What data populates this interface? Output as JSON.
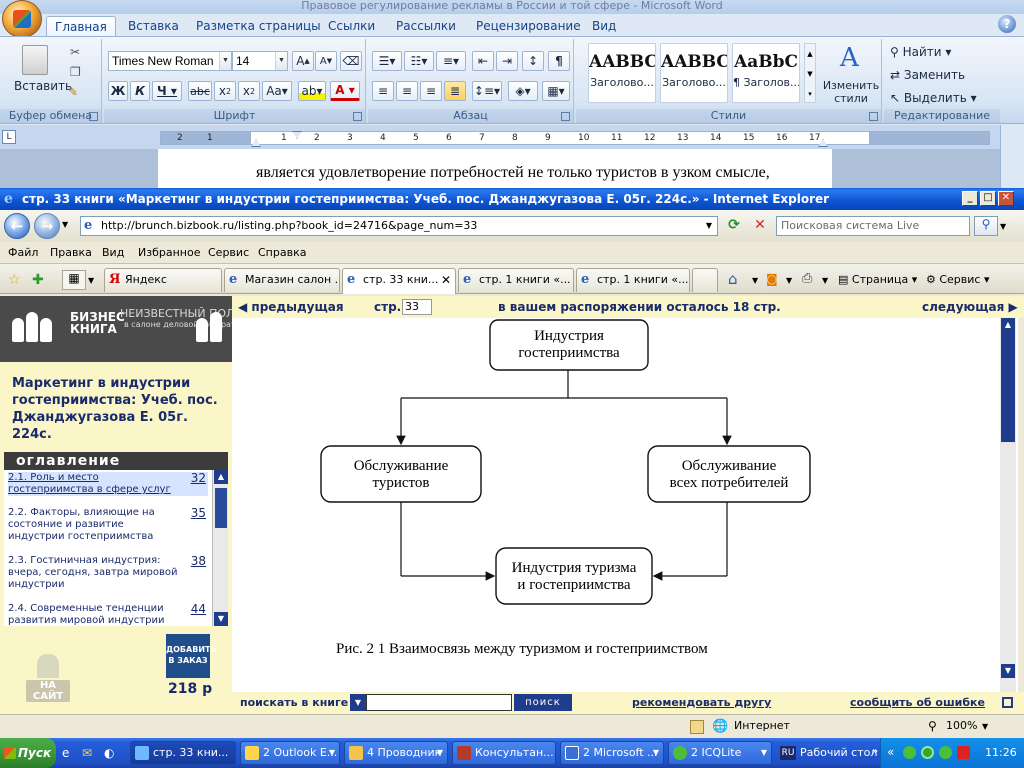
{
  "word": {
    "title": "Правовое регулирование рекламы в России и той сфере - Microsoft Word",
    "tabs": [
      "Главная",
      "Вставка",
      "Разметка страницы",
      "Ссылки",
      "Рассылки",
      "Рецензирование",
      "Вид"
    ],
    "groups": [
      "Буфер обмена",
      "Шрифт",
      "Абзац",
      "Стили",
      "Редактирование"
    ],
    "paste_label": "Вставить",
    "font_name": "Times New Roman",
    "font_size": "14",
    "styles": [
      {
        "sample": "AABBC",
        "name": "Заголово..."
      },
      {
        "sample": "AABBC",
        "name": "Заголово..."
      },
      {
        "sample": "AaBbC",
        "name": "¶ Заголов..."
      }
    ],
    "change_styles": "Изменить стили",
    "editing": [
      "Найти",
      "Заменить",
      "Выделить"
    ],
    "ruler_ticks": [
      "1",
      "2",
      "3",
      "4",
      "5",
      "6",
      "7",
      "8",
      "9",
      "10",
      "11",
      "12",
      "13",
      "14",
      "15",
      "16",
      "17"
    ],
    "ruler_left": [
      "2",
      "1",
      "1"
    ],
    "doc_text": "является удовлетворение потребностей не только туристов в узком смысле,"
  },
  "ie": {
    "title": "стр. 33 книги «Маркетинг в индустрии гостеприимства: Учеб. пос. Джанджугазова Е. 05г. 224с.» - Internet Explorer",
    "url": "http://brunch.bizbook.ru/listing.php?book_id=24716&page_num=33",
    "search_placeholder": "Поисковая система Live",
    "menu": [
      "Файл",
      "Правка",
      "Вид",
      "Избранное",
      "Сервис",
      "Справка"
    ],
    "tabs": [
      "Яндекс",
      "Магазин салон ...",
      "стр. 33 кни...",
      "стр. 1 книги «...",
      "стр. 1 книги «..."
    ],
    "tools": [
      "Страница",
      "Сервис"
    ]
  },
  "page": {
    "logo_text": "БИЗНЕС КНИГА",
    "logo_user": "НЕИЗВЕСТНЫЙ ПОЛЬЗОВАТЕЛЬ",
    "logo_sub": "в салоне деловой литературы",
    "book_title": "Маркетинг в индустрии гостеприимства: Учеб. пос. Джанджугазова Е. 05г. 224с.",
    "toc_header": "оглавление",
    "toc": [
      {
        "title": "2.1. Роль и место гостеприимства в сфере услуг",
        "page": "32"
      },
      {
        "title": "2.2. Факторы, влияющие на состояние и развитие индустрии гостеприимства",
        "page": "35"
      },
      {
        "title": "2.3. Гостиничная индустрия: вчера, сегодня, завтра мировой индустрии",
        "page": "38"
      },
      {
        "title": "2.4. Современные тенденции развития мировой индустрии",
        "page": "44"
      }
    ],
    "na_site": "НА САЙТ",
    "order_btn": "ДОБАВИТЬ В ЗАКАЗ",
    "price": "218 р",
    "nav_prev": "предыдущая",
    "nav_page_label": "стр.",
    "nav_page_value": "33",
    "nav_remaining": "в вашем распоряжении осталось 18 стр.",
    "nav_next": "следующая",
    "diagram": {
      "top": "Индустрия гостеприимства",
      "left": "Обслуживание туристов",
      "right": "Обслуживание всех потребителей",
      "bottom": "Индустрия туризма и гостеприимства",
      "caption": "Рис. 2 1  Взаимосвязь между туризмом и гостеприимством"
    },
    "bottom_search": "поискать в книге",
    "search_btn": "поиск",
    "recommend": "рекомендовать другу",
    "report": "сообщить об ошибке"
  },
  "status": {
    "zone": "Интернет",
    "zoom": "100%"
  },
  "taskbar": {
    "start": "Пуск",
    "items": [
      "стр. 33 кни...",
      "2 Outlook E...",
      "4 Проводник",
      "Консультан...",
      "2 Microsoft ...",
      "2 ICQLite"
    ],
    "desktop": "Рабочий стол",
    "clock": "11:26"
  }
}
